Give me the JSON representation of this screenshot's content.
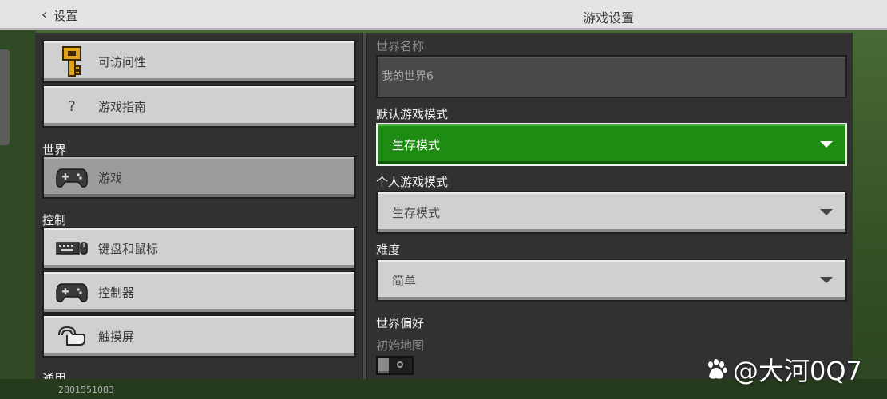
{
  "topbar": {
    "back_label": "设置",
    "title": "游戏设置"
  },
  "sidebar": {
    "items_top": [
      {
        "label": "可访问性",
        "icon": "key-icon"
      },
      {
        "label": "游戏指南",
        "icon": "question-icon",
        "glyph": "?"
      }
    ],
    "sections": [
      {
        "label": "世界",
        "items": [
          {
            "label": "游戏",
            "icon": "gamepad-icon",
            "active": true
          }
        ]
      },
      {
        "label": "控制",
        "items": [
          {
            "label": "键盘和鼠标",
            "icon": "keyboard-mouse-icon"
          },
          {
            "label": "控制器",
            "icon": "gamepad-icon"
          },
          {
            "label": "触摸屏",
            "icon": "touch-icon"
          }
        ]
      },
      {
        "label": "通用"
      }
    ]
  },
  "main": {
    "world_name": {
      "label": "世界名称",
      "value": "我的世界6"
    },
    "default_game_mode": {
      "label": "默认游戏模式",
      "value": "生存模式"
    },
    "personal_game_mode": {
      "label": "个人游戏模式",
      "value": "生存模式"
    },
    "difficulty": {
      "label": "难度",
      "value": "简单"
    },
    "world_preferences": {
      "label": "世界偏好"
    },
    "starting_map": {
      "label": "初始地图",
      "enabled": false
    }
  },
  "footer": {
    "version": "2801551083",
    "watermark": "@大河0Q7"
  },
  "colors": {
    "accent_green": "#1e8b12",
    "panel_bg": "#313131",
    "button_bg": "#d0d0d0"
  }
}
